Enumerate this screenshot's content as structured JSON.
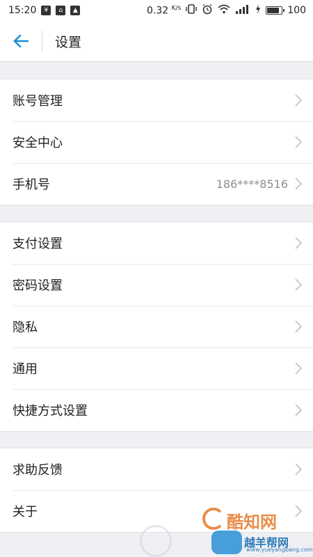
{
  "status_bar": {
    "time": "15:20",
    "net_speed": "0.32",
    "net_speed_unit": "K/s",
    "battery_level": "100"
  },
  "header": {
    "title": "设置",
    "back_icon": "arrow-left-icon"
  },
  "groups": [
    {
      "items": [
        {
          "label": "账号管理",
          "value": ""
        },
        {
          "label": "安全中心",
          "value": ""
        },
        {
          "label": "手机号",
          "value": "186****8516"
        }
      ]
    },
    {
      "items": [
        {
          "label": "支付设置",
          "value": ""
        },
        {
          "label": "密码设置",
          "value": ""
        },
        {
          "label": "隐私",
          "value": ""
        },
        {
          "label": "通用",
          "value": ""
        },
        {
          "label": "快捷方式设置",
          "value": ""
        }
      ]
    },
    {
      "items": [
        {
          "label": "求助反馈",
          "value": ""
        },
        {
          "label": "关于",
          "value": ""
        }
      ]
    }
  ],
  "watermark": {
    "brand1": "酷知网",
    "brand2": "越羊帮网",
    "url": "www.yueyangbang.com"
  },
  "colors": {
    "accent": "#1a8ed6",
    "background": "#efeff4",
    "chevron": "#c4c4c4",
    "value_text": "#8e8e8e"
  }
}
